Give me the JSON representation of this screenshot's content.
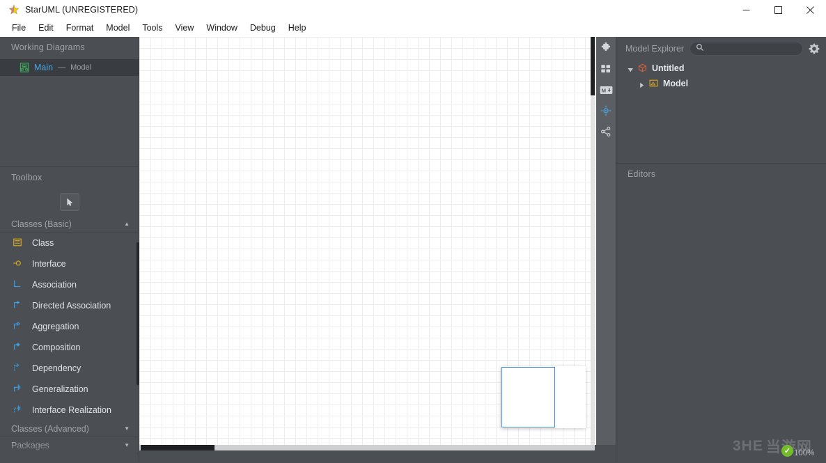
{
  "window": {
    "title": "StarUML (UNREGISTERED)",
    "app_icon": "star-icon",
    "controls": {
      "minimize": "—",
      "maximize": "□",
      "close": "✕"
    }
  },
  "menubar": {
    "items": [
      {
        "label": "File"
      },
      {
        "label": "Edit"
      },
      {
        "label": "Format"
      },
      {
        "label": "Model"
      },
      {
        "label": "Tools"
      },
      {
        "label": "View"
      },
      {
        "label": "Window"
      },
      {
        "label": "Debug"
      },
      {
        "label": "Help"
      }
    ]
  },
  "working_diagrams": {
    "title": "Working Diagrams",
    "items": [
      {
        "name": "Main",
        "separator": "—",
        "type": "Model",
        "icon": "class-diagram-icon",
        "selected": true
      }
    ]
  },
  "toolbox": {
    "title": "Toolbox",
    "select_tool": {
      "icon": "cursor-arrow-icon",
      "active": true
    },
    "groups": [
      {
        "label": "Classes (Basic)",
        "expanded": true,
        "caret": "▲",
        "items": [
          {
            "label": "Class",
            "icon": "class-icon"
          },
          {
            "label": "Interface",
            "icon": "interface-icon"
          },
          {
            "label": "Association",
            "icon": "association-icon"
          },
          {
            "label": "Directed Association",
            "icon": "directed-association-icon"
          },
          {
            "label": "Aggregation",
            "icon": "aggregation-icon"
          },
          {
            "label": "Composition",
            "icon": "composition-icon"
          },
          {
            "label": "Dependency",
            "icon": "dependency-icon"
          },
          {
            "label": "Generalization",
            "icon": "generalization-icon"
          },
          {
            "label": "Interface Realization",
            "icon": "interface-realization-icon"
          }
        ]
      },
      {
        "label": "Classes (Advanced)",
        "expanded": false,
        "caret": "▼",
        "items": []
      },
      {
        "label": "Packages",
        "expanded": false,
        "caret": "▼",
        "items": []
      }
    ]
  },
  "canvas": {
    "grid_size_px": 16,
    "background": "#ffffff",
    "grid_color": "#ededed",
    "minimap": {
      "name": "diagram-minimap",
      "viewport_color": "#3b86d4"
    },
    "icon_rail": [
      {
        "name": "extensions-icon",
        "glyph": "puzzle",
        "active": false
      },
      {
        "name": "blocks-icon",
        "glyph": "blocks",
        "active": false
      },
      {
        "name": "markdown-icon",
        "glyph": "M↓",
        "active": false
      },
      {
        "name": "target-align-icon",
        "glyph": "target",
        "active": true
      },
      {
        "name": "share-icon",
        "glyph": "share",
        "active": false
      }
    ]
  },
  "model_explorer": {
    "title": "Model Explorer",
    "search": {
      "placeholder": "",
      "value": "",
      "icon": "search-icon"
    },
    "settings_icon": "gear-icon",
    "tree": [
      {
        "label": "Untitled",
        "icon": "project-icon",
        "twisty": "◢",
        "expanded": true,
        "depth": 0
      },
      {
        "label": "Model",
        "icon": "model-folder-icon",
        "twisty": "▶",
        "expanded": false,
        "depth": 1
      }
    ]
  },
  "editors": {
    "title": "Editors"
  },
  "statusbar": {
    "zoom": "100%",
    "watermark_text": "当游网",
    "watermark_brand": "3HE",
    "check_icon": "check-circle-icon"
  },
  "colors": {
    "chrome": "#4b4f54",
    "panel_alt": "#393d42",
    "accent_blue": "#4aa3e0",
    "accent_gold": "#d4a017",
    "accent_green": "#73bd2a",
    "text_primary": "#e4e7ea",
    "text_muted": "#9ea3a8"
  }
}
